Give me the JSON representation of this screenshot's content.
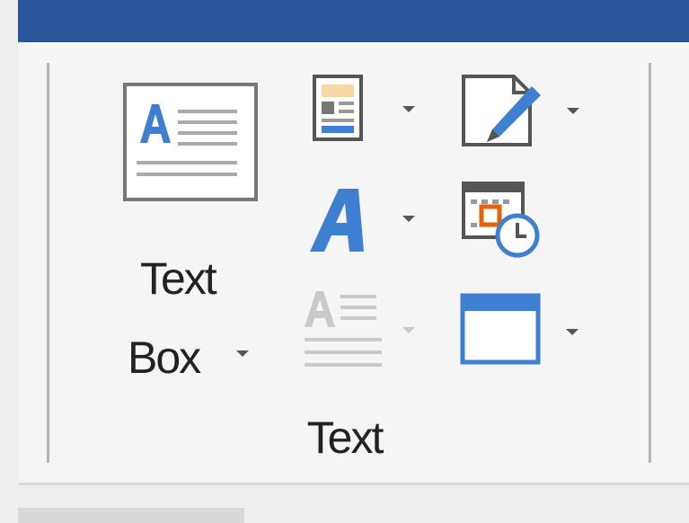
{
  "colors": {
    "title_bar": "#2b579a",
    "ribbon_bg": "#f5f5f5",
    "accent_blue": "#3f7fd1",
    "accent_orange": "#e5630b",
    "icon_gray": "#555555"
  },
  "text_group": {
    "text_box": {
      "line1": "Text",
      "line2": "Box",
      "icon": "text-box-icon"
    },
    "group_label": "Text",
    "buttons": [
      {
        "name": "quick-parts-button",
        "icon": "quick-parts-icon"
      },
      {
        "name": "wordart-button",
        "icon": "wordart-icon"
      },
      {
        "name": "drop-cap-button",
        "icon": "drop-cap-icon",
        "enabled": false
      },
      {
        "name": "signature-line-button",
        "icon": "signature-line-icon"
      },
      {
        "name": "date-time-button",
        "icon": "date-time-icon"
      },
      {
        "name": "object-button",
        "icon": "object-icon"
      }
    ]
  }
}
